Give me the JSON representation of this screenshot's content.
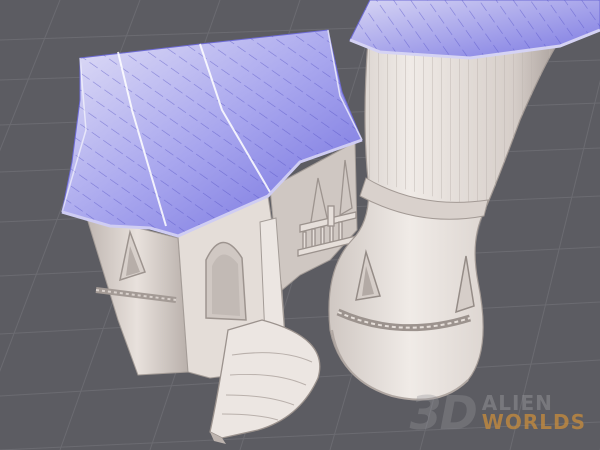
{
  "scene": {
    "background_color": "#5c5c62",
    "grid_color": "#6a6a70",
    "roof_color": "#8f8fe8",
    "wall_color": "#dcd4cf"
  },
  "watermark": {
    "mark": "3D",
    "line1": "ALIEN",
    "line2": "WORLDS",
    "accent_color": "#c88c3c"
  }
}
